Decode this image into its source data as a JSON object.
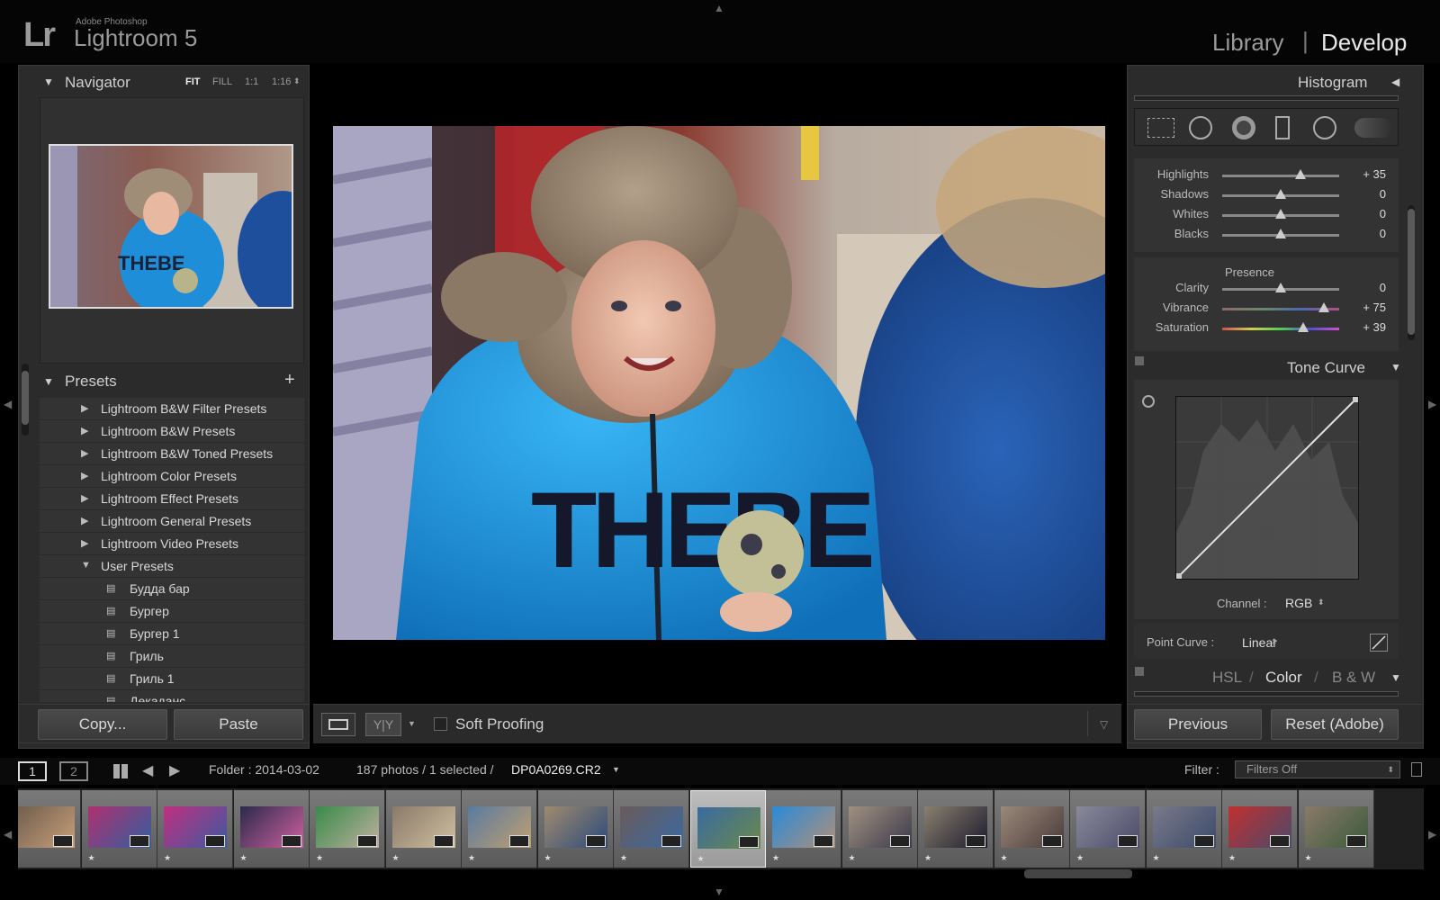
{
  "app": {
    "small_brand": "Adobe Photoshop",
    "name": "Lightroom 5",
    "logo": "Lr"
  },
  "modules": {
    "library": "Library",
    "separator": "|",
    "develop": "Develop"
  },
  "navigator": {
    "title": "Navigator",
    "options": [
      "FIT",
      "FILL",
      "1:1",
      "1:16"
    ]
  },
  "presets": {
    "title": "Presets",
    "add": "+",
    "groups": [
      "Lightroom B&W Filter Presets",
      "Lightroom B&W Presets",
      "Lightroom B&W Toned Presets",
      "Lightroom Color Presets",
      "Lightroom Effect Presets",
      "Lightroom General Presets",
      "Lightroom Video Presets",
      "User Presets"
    ],
    "user_items": [
      "Будда бар",
      "Бургер",
      "Бургер 1",
      "Гриль",
      "Гриль 1",
      "Декаданс"
    ]
  },
  "left_buttons": {
    "copy": "Copy...",
    "paste": "Paste"
  },
  "toolbar": {
    "soft_proofing": "Soft Proofing"
  },
  "histogram": {
    "title": "Histogram"
  },
  "tone": {
    "highlights": {
      "label": "Highlights",
      "value": "+ 35",
      "pos": 0.67
    },
    "shadows": {
      "label": "Shadows",
      "value": "0",
      "pos": 0.5
    },
    "whites": {
      "label": "Whites",
      "value": "0",
      "pos": 0.5
    },
    "blacks": {
      "label": "Blacks",
      "value": "0",
      "pos": 0.5
    }
  },
  "presence": {
    "title": "Presence",
    "clarity": {
      "label": "Clarity",
      "value": "0",
      "pos": 0.5
    },
    "vibrance": {
      "label": "Vibrance",
      "value": "+ 75",
      "pos": 0.87
    },
    "saturation": {
      "label": "Saturation",
      "value": "+ 39",
      "pos": 0.69
    }
  },
  "tone_curve": {
    "title": "Tone Curve",
    "channel_label": "Channel :",
    "channel": "RGB",
    "point_curve_label": "Point Curve :",
    "point_curve": "Linear"
  },
  "hsl": {
    "hsl": "HSL",
    "sep": "/",
    "color": "Color",
    "bw": "B & W"
  },
  "right_buttons": {
    "previous": "Previous",
    "reset": "Reset (Adobe)"
  },
  "filmbar": {
    "screen1": "1",
    "screen2": "2",
    "folder": "Folder : 2014-03-02",
    "count": "187 photos / 1 selected /",
    "file": "DP0A0269.CR2",
    "filter_label": "Filter :",
    "filter_value": "Filters Off"
  },
  "filmstrip": {
    "star": "★",
    "thumb_count": 18,
    "selected_index": 9
  }
}
